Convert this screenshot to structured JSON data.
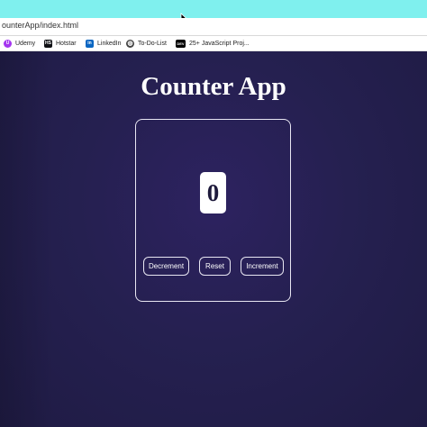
{
  "browser": {
    "url": "ounterApp/index.html",
    "bookmarks": [
      {
        "label": "Udemy",
        "icon": "udemy-icon",
        "color": "#a435f0",
        "glyph": "U"
      },
      {
        "label": "Hotstar",
        "icon": "hotstar-icon",
        "color": "#0f1014",
        "glyph": "HS"
      },
      {
        "label": "LinkedIn",
        "icon": "linkedin-icon",
        "color": "#0a66c2",
        "glyph": "in"
      },
      {
        "label": "To-Do-List",
        "icon": "globe-icon",
        "color": "#444444",
        "glyph": "◍"
      },
      {
        "label": "25+ JavaScript Proj...",
        "icon": "dev-icon",
        "color": "#000000",
        "glyph": "DEV"
      }
    ],
    "topbar_color": "#7ff0ee"
  },
  "app": {
    "title": "Counter App",
    "count": "0",
    "buttons": {
      "decrement": "Decrement",
      "reset": "Reset",
      "increment": "Increment"
    }
  },
  "colors": {
    "background": "#241e50",
    "foreground": "#ffffff"
  }
}
